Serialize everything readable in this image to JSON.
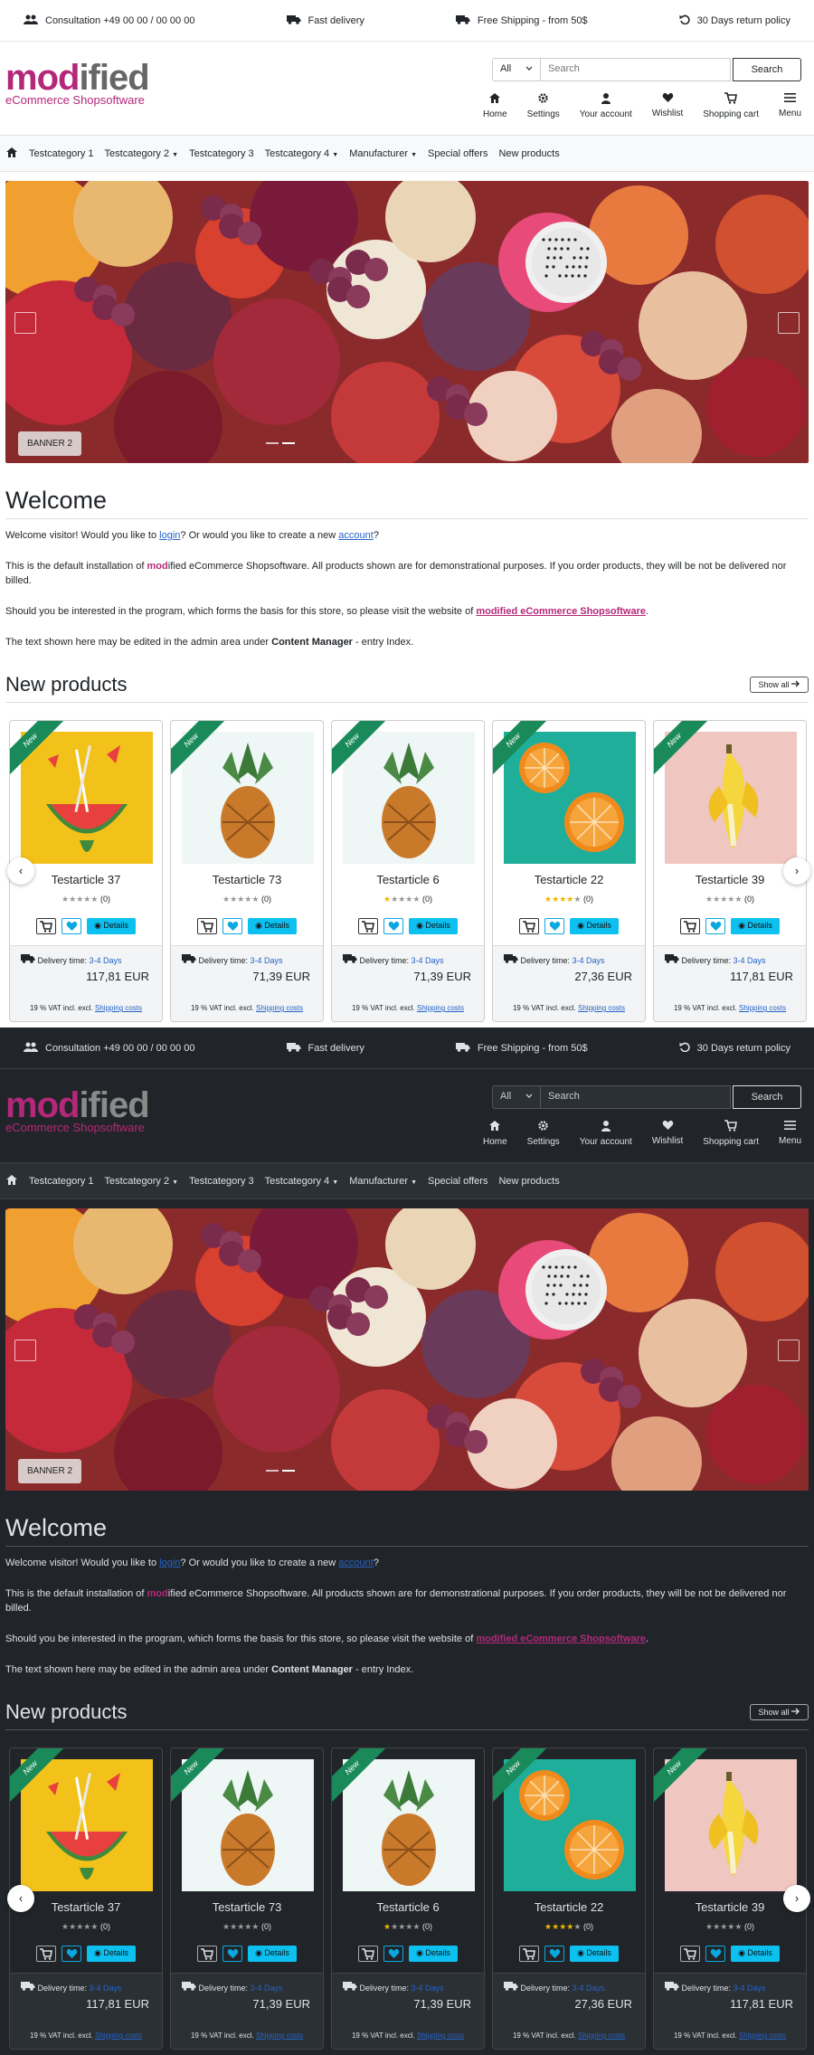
{
  "topbar": {
    "consultation": "Consultation +49 00 00 / 00 00 00",
    "delivery": "Fast delivery",
    "shipping": "Free Shipping - from 50$",
    "returns": "30 Days return policy"
  },
  "logo": {
    "m": "mod",
    "rest": "ified",
    "sub": "eCommerce Shopsoftware"
  },
  "search": {
    "select": "All",
    "placeholder": "Search",
    "button": "Search"
  },
  "iconnav": [
    {
      "label": "Home",
      "icon": "home-icon"
    },
    {
      "label": "Settings",
      "icon": "gear-icon"
    },
    {
      "label": "Your account",
      "icon": "user-icon"
    },
    {
      "label": "Wishlist",
      "icon": "heart-icon"
    },
    {
      "label": "Shopping cart",
      "icon": "cart-icon"
    },
    {
      "label": "Menu",
      "icon": "menu-icon"
    }
  ],
  "catnav": [
    "Testcategory 1",
    "Testcategory 2",
    "Testcategory 3",
    "Testcategory 4",
    "Manufacturer",
    "Special offers",
    "New products"
  ],
  "banner": {
    "tag": "BANNER 2"
  },
  "welcome": {
    "title": "Welcome",
    "p1a": "Welcome visitor! Would you like to ",
    "login": "login",
    "p1b": "? Or would you like to create a new ",
    "account": "account",
    "p1c": "?",
    "p2a": "This is the default installation of ",
    "p2brand_m": "mod",
    "p2brand_r": "ified",
    "p2b": " eCommerce Shopsoftware. All products shown are for demonstrational purposes. If you order products, they will be not be delivered nor billed.",
    "p3a": "Should you be interested in the program, which forms the basis for this store, so please visit the website of ",
    "p3link": "modified eCommerce Shopsoftware",
    "p3b": ".",
    "p4a": "The text shown here may be edited in the admin area under ",
    "p4b": "Content Manager",
    "p4c": " - entry Index."
  },
  "newproducts": {
    "title": "New products",
    "showall": "Show all"
  },
  "products": [
    {
      "name": "Testarticle 37",
      "stars": 0,
      "count": "(0)",
      "price": "117,81 EUR",
      "img": "watermelon"
    },
    {
      "name": "Testarticle 73",
      "stars": 0,
      "count": "(0)",
      "price": "71,39 EUR",
      "img": "pineapple"
    },
    {
      "name": "Testarticle 6",
      "stars": 1,
      "count": "(0)",
      "price": "71,39 EUR",
      "img": "pineapple"
    },
    {
      "name": "Testarticle 22",
      "stars": 4,
      "count": "(0)",
      "price": "27,36 EUR",
      "img": "orange"
    },
    {
      "name": "Testarticle 39",
      "stars": 0,
      "count": "(0)",
      "price": "117,81 EUR",
      "img": "banana"
    }
  ],
  "card": {
    "new": "New",
    "details": "Details",
    "delivery_label": "Delivery time:",
    "delivery_value": "3-4 Days",
    "vat_light": "19 % VAT incl. excl.",
    "vat_dark": "19 % VAT incl. excl.",
    "shipping": "Shipping costs"
  },
  "colors": {
    "brand": "#b4287a",
    "accent": "#0cc0f0",
    "ribbon": "#1a8a5a"
  }
}
